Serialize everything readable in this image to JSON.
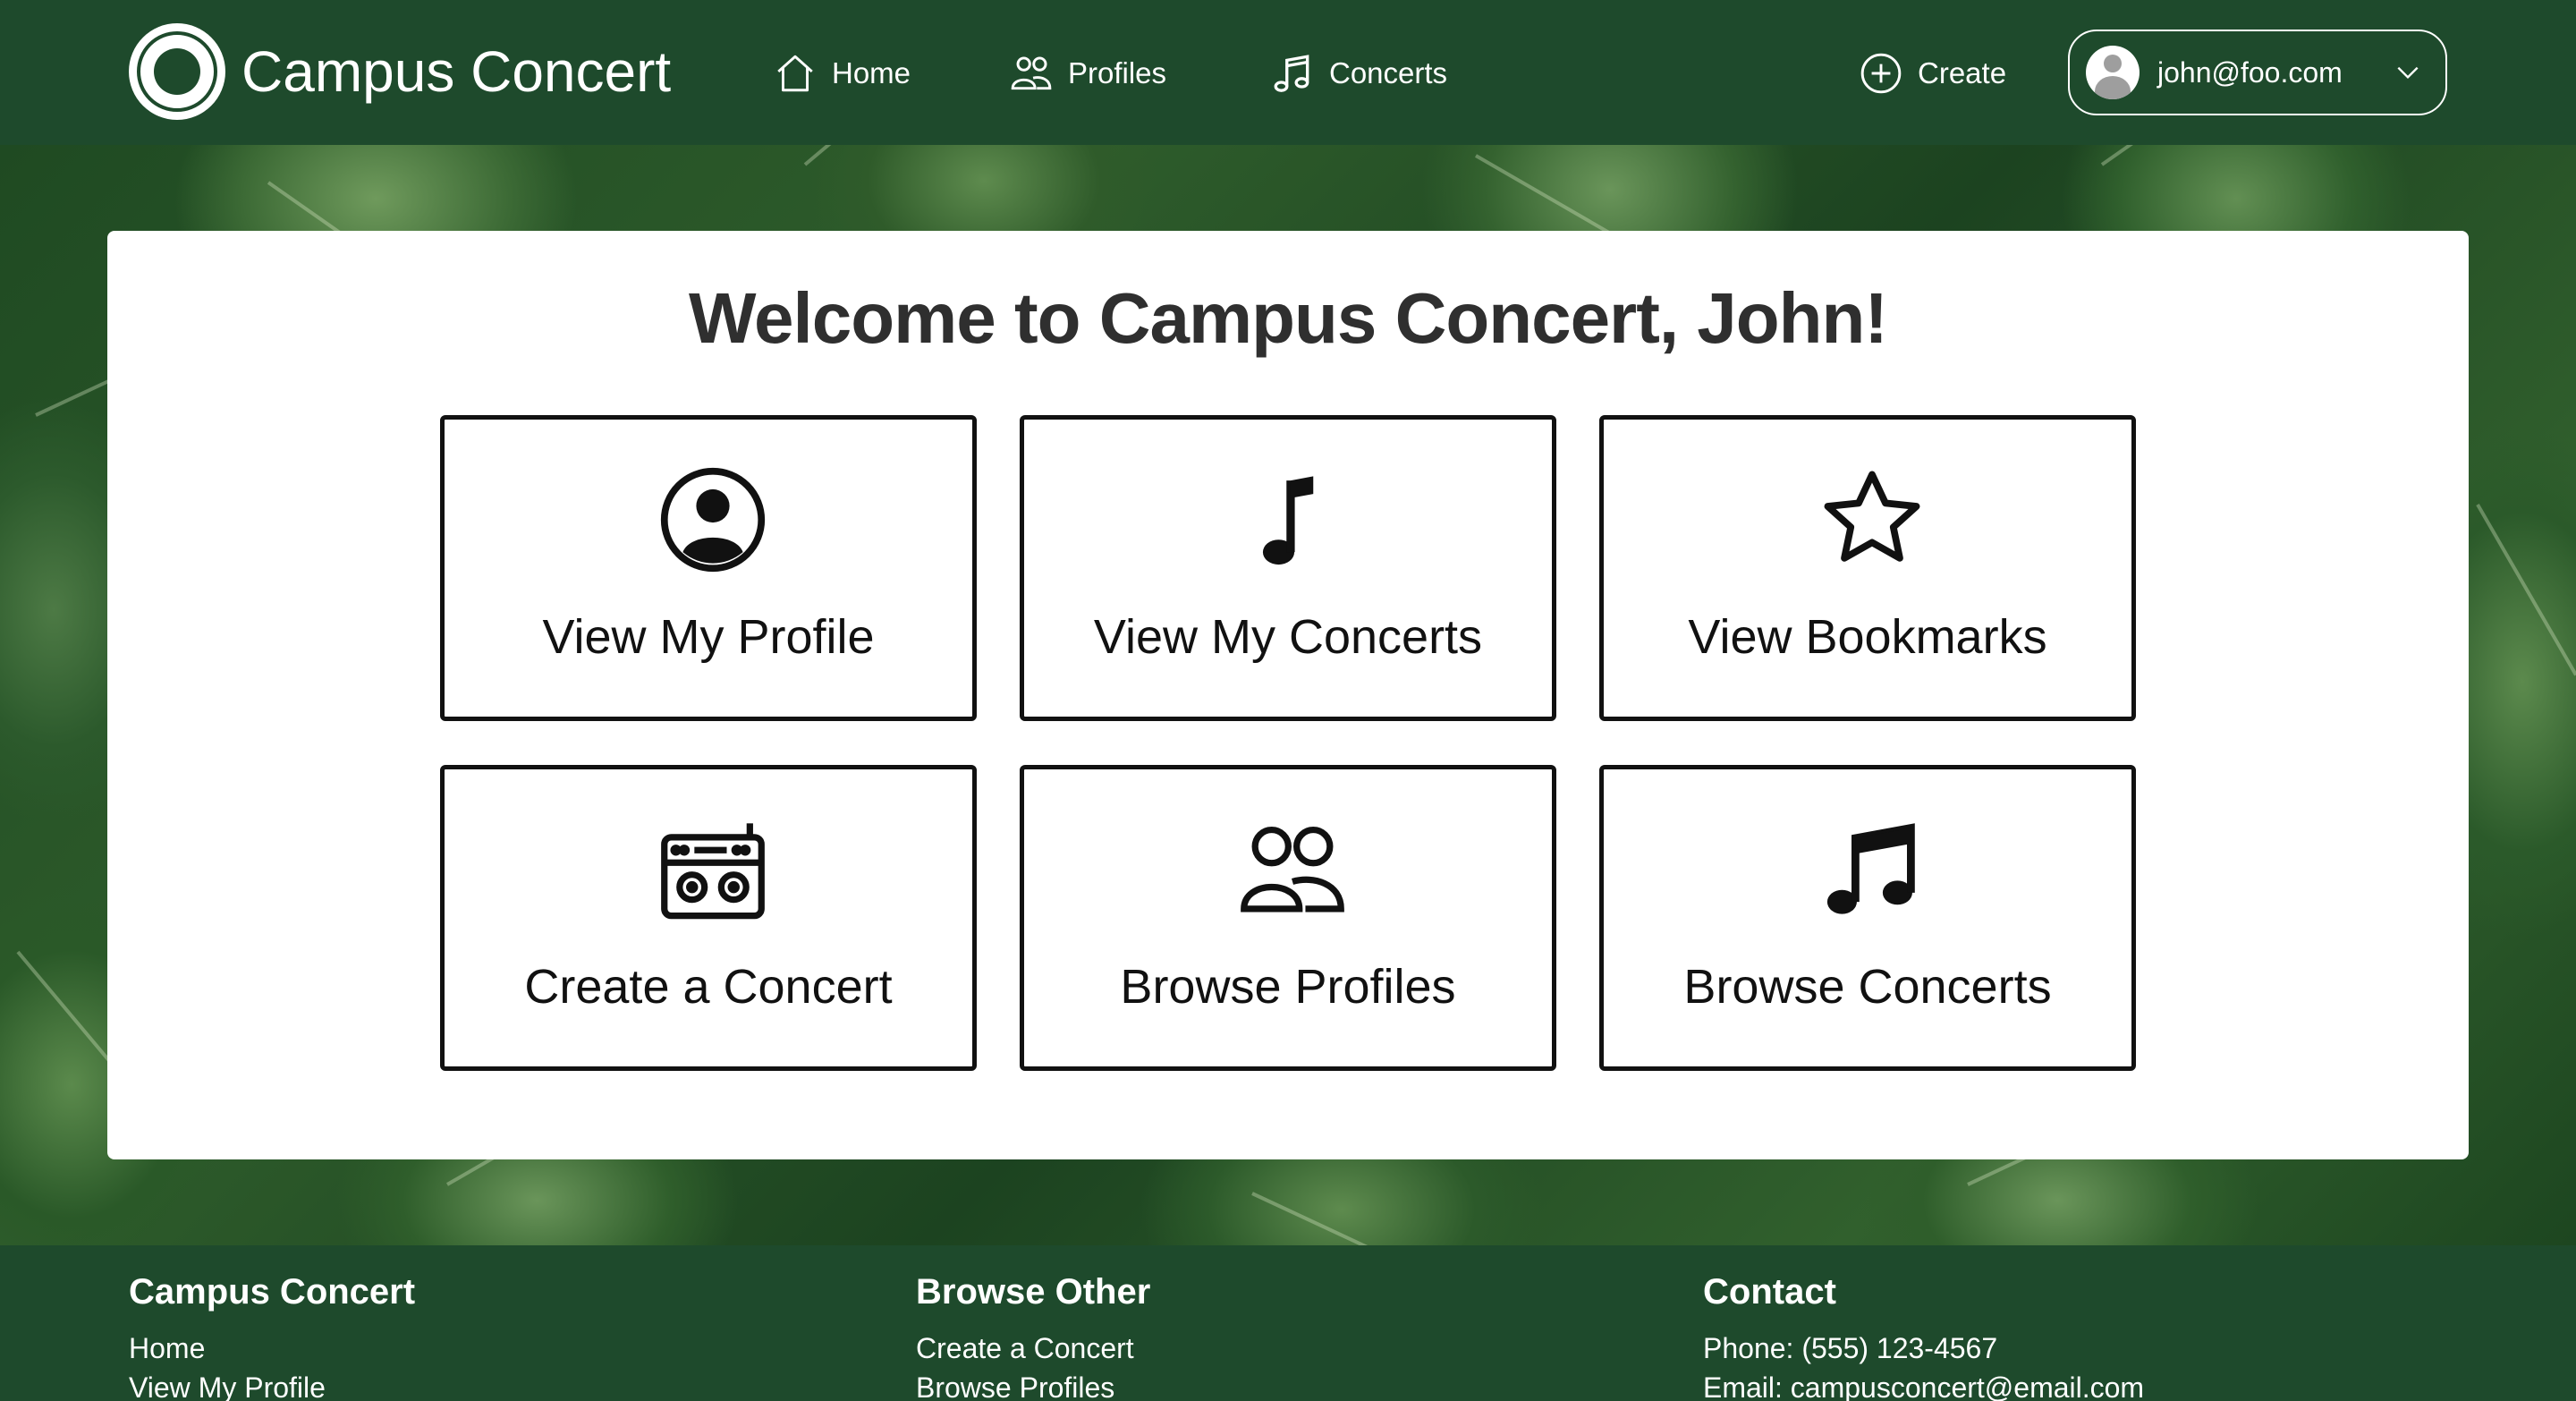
{
  "navbar": {
    "brand": "Campus Concert",
    "links": [
      {
        "label": "Home",
        "icon": "house-icon"
      },
      {
        "label": "Profiles",
        "icon": "people-icon"
      },
      {
        "label": "Concerts",
        "icon": "music-note-beamed-icon"
      }
    ],
    "create_label": "Create",
    "user_email": "john@foo.com"
  },
  "welcome": {
    "title": "Welcome to Campus Concert, John!",
    "tiles": [
      {
        "label": "View My Profile",
        "icon": "person-circle-icon"
      },
      {
        "label": "View My Concerts",
        "icon": "music-note-icon"
      },
      {
        "label": "View Bookmarks",
        "icon": "star-icon"
      },
      {
        "label": "Create a Concert",
        "icon": "boombox-icon"
      },
      {
        "label": "Browse Profiles",
        "icon": "people-icon"
      },
      {
        "label": "Browse Concerts",
        "icon": "music-note-beamed-icon"
      }
    ]
  },
  "footer": {
    "columns": [
      {
        "heading": "Campus Concert",
        "links": [
          "Home",
          "View My Profile"
        ]
      },
      {
        "heading": "Browse Other",
        "links": [
          "Create a Concert",
          "Browse Profiles"
        ]
      },
      {
        "heading": "Contact",
        "links": [
          "Phone: (555) 123-4567",
          "Email: campusconcert@email.com"
        ]
      }
    ]
  },
  "colors": {
    "primary_green": "#1e4a2c",
    "card_bg": "#ffffff",
    "title_text": "#2f2f2f",
    "tile_border": "#111111"
  }
}
